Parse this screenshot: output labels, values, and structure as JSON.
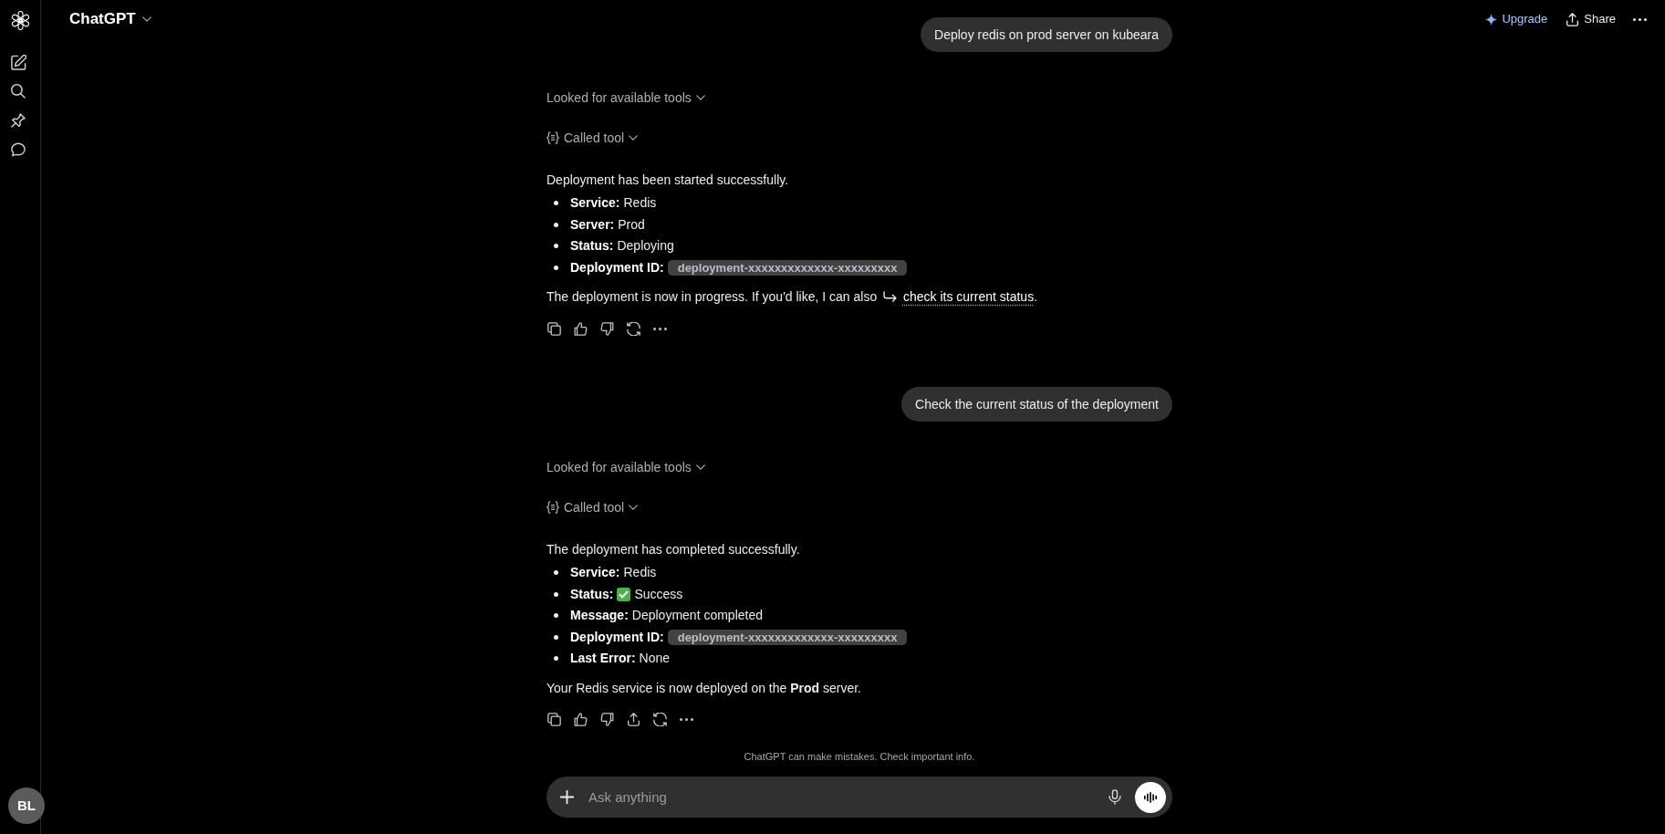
{
  "sidebar": {
    "avatar": "BL"
  },
  "header": {
    "title": "ChatGPT",
    "upgrade": "Upgrade",
    "share": "Share"
  },
  "messages": [
    {
      "kind": "user",
      "text": "Deploy redis on prod server on kubeara"
    },
    {
      "kind": "assistant",
      "steps": [
        {
          "kind": "plain",
          "label": "Looked for available tools",
          "expanded": false
        },
        {
          "kind": "tool",
          "label": "Called tool",
          "expanded": false
        }
      ],
      "intro": "Deployment has been started successfully.",
      "items": [
        {
          "kind": "text",
          "label": "Service:",
          "value": "Redis"
        },
        {
          "kind": "text",
          "label": "Server:",
          "value": "Prod"
        },
        {
          "kind": "text",
          "label": "Status:",
          "value": "Deploying"
        },
        {
          "kind": "code",
          "label": "Deployment ID:",
          "value": "deployment-xxxxxxxxxxxxx-xxxxxxxxx"
        }
      ],
      "closing": {
        "text": "The deployment is now in progress. If you'd like, I can also",
        "link": "check its current status",
        "after": "."
      },
      "actions": [
        {
          "kind": "copy"
        },
        {
          "kind": "like"
        },
        {
          "kind": "dislike"
        },
        {
          "kind": "regenerate"
        },
        {
          "kind": "more"
        }
      ]
    },
    {
      "kind": "user",
      "text": "Check the current status of the deployment"
    },
    {
      "kind": "assistant",
      "steps": [
        {
          "kind": "plain",
          "label": "Looked for available tools",
          "expanded": false
        },
        {
          "kind": "tool",
          "label": "Called tool",
          "expanded": false
        }
      ],
      "intro": "The deployment has completed successfully.",
      "items": [
        {
          "kind": "text",
          "label": "Service:",
          "value": "Redis"
        },
        {
          "kind": "success",
          "label": "Status:",
          "value": "Success"
        },
        {
          "kind": "text",
          "label": "Message:",
          "value": "Deployment completed"
        },
        {
          "kind": "code",
          "label": "Deployment ID:",
          "value": "deployment-xxxxxxxxxxxxx-xxxxxxxxx"
        },
        {
          "kind": "text",
          "label": "Last Error:",
          "value": "None"
        }
      ],
      "closing": {
        "text": "Your Redis service is now deployed on the **Prod** server."
      },
      "actions": [
        {
          "kind": "copy"
        },
        {
          "kind": "like"
        },
        {
          "kind": "dislike"
        },
        {
          "kind": "share"
        },
        {
          "kind": "regenerate"
        },
        {
          "kind": "more"
        }
      ]
    }
  ],
  "footer": {
    "disclaimer": "ChatGPT can make mistakes. Check important info.",
    "composer": {
      "placeholder": "Ask anything"
    }
  }
}
